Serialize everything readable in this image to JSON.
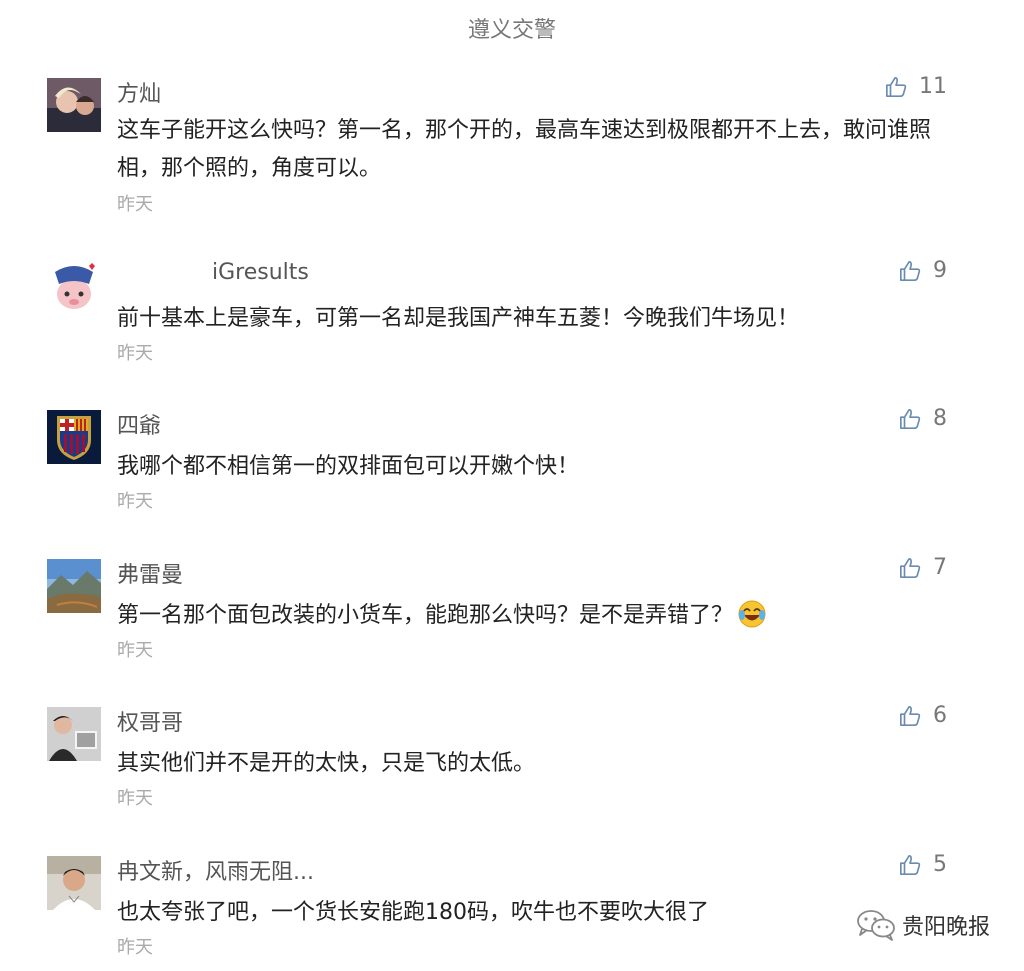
{
  "header": {
    "title": "遵义交警"
  },
  "comments": [
    {
      "name": "方灿",
      "likes": "11",
      "text": "这车子能开这么快吗？第一名，那个开的，最高车速达到极限都开不上去，敢问谁照相，那个照的，角度可以。",
      "time": "昨天"
    },
    {
      "name": "iGresults",
      "likes": "9",
      "text": "前十基本上是豪车，可第一名却是我国产神车五菱！今晚我们牛场见！",
      "time": "昨天"
    },
    {
      "name": "四爺",
      "likes": "8",
      "text": "我哪个都不相信第一的双排面包可以开嫩个快！",
      "time": "昨天"
    },
    {
      "name": "弗雷曼",
      "likes": "7",
      "text": "第一名那个面包改装的小货车，能跑那么快吗？是不是弄错了？",
      "time": "昨天",
      "emoji": "laughing-crying-emoji"
    },
    {
      "name": "权哥哥",
      "likes": "6",
      "text": "其实他们并不是开的太快，只是飞的太低。",
      "time": "昨天"
    },
    {
      "name": "冉文新，风雨无阻...",
      "likes": "5",
      "text": "也太夸张了吧，一个货长安能跑180码，吹牛也不要吹大很了",
      "time": "昨天"
    }
  ],
  "watermark": {
    "text": "贵阳晚报",
    "icon": "wechat-icon"
  },
  "colors": {
    "like": "#777777",
    "time": "#aaaaaa",
    "text": "#222222",
    "title": "#777777"
  }
}
